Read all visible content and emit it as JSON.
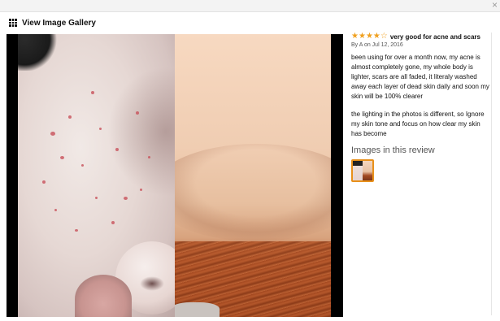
{
  "window": {
    "close_glyph": "×"
  },
  "gallery": {
    "label": "View Image Gallery",
    "icon": "grid-icon"
  },
  "review": {
    "rating": 4,
    "max_rating": 5,
    "title": "very good for acne and scars",
    "byline": "By A on Jul 12, 2016",
    "paragraphs": [
      "been using for over a month now, my acne is almost completely gone, my whole body is lighter, scars are all faded, it literaly washed away each layer of dead skin daily and soon my skin will be 100% clearer",
      "the lighting in the photos is different, so Ignore my skin tone and focus on how clear my skin has become"
    ],
    "images_heading": "Images in this review"
  },
  "colors": {
    "star": "#f0a01f",
    "thumb_border": "#e8901a"
  }
}
